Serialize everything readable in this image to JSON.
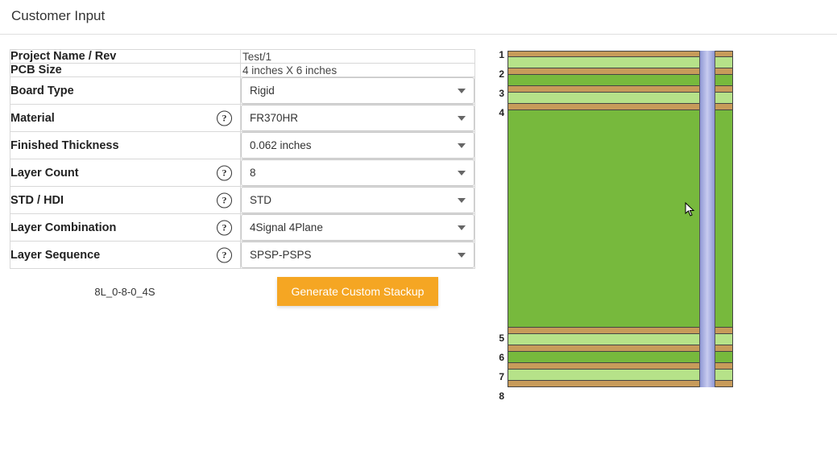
{
  "page": {
    "title": "Customer Input"
  },
  "form": {
    "project_name": {
      "label": "Project Name / Rev",
      "value": "Test/1"
    },
    "pcb_size": {
      "label": "PCB Size",
      "value": "4 inches X 6 inches"
    },
    "board_type": {
      "label": "Board Type",
      "value": "Rigid"
    },
    "material": {
      "label": "Material",
      "value": "FR370HR"
    },
    "thickness": {
      "label": "Finished Thickness",
      "value": "0.062 inches"
    },
    "layer_count": {
      "label": "Layer Count",
      "value": "8"
    },
    "std_hdi": {
      "label": "STD / HDI",
      "value": "STD"
    },
    "layer_comb": {
      "label": "Layer Combination",
      "value": "4Signal 4Plane"
    },
    "layer_seq": {
      "label": "Layer Sequence",
      "value": "SPSP-PSPS"
    }
  },
  "footer": {
    "stackup_code": "8L_0-8-0_4S",
    "generate_label": "Generate Custom Stackup"
  },
  "diagram": {
    "layer_numbers": [
      "1",
      "2",
      "3",
      "4",
      "5",
      "6",
      "7",
      "8"
    ]
  },
  "help_glyph": "?"
}
